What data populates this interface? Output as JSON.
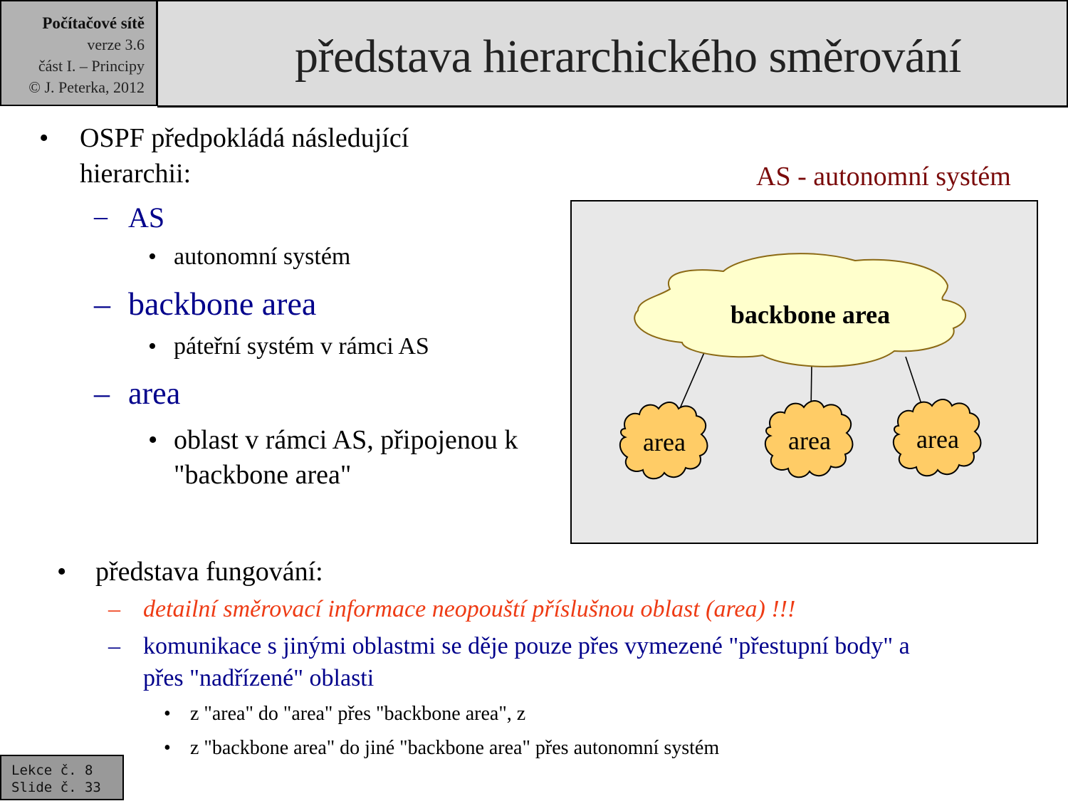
{
  "header": {
    "course": "Počítačové sítě",
    "version": "verze 3.6",
    "part": "část I.  –  Principy",
    "copyright": "© J. Peterka, 2012",
    "title": "představa hierarchického směrování"
  },
  "content": {
    "intro": {
      "bullet": "•",
      "line1": "OSPF předpokládá  následující",
      "line2": "hierarchii:"
    },
    "levels": [
      {
        "dash": "–",
        "term": "AS",
        "bullet": "•",
        "desc": "autonomní systém"
      },
      {
        "dash": "–",
        "term": "backbone area",
        "bullet": "•",
        "desc": "páteřní systém v rámci AS"
      },
      {
        "dash": "–",
        "term": "area",
        "bullet": "•",
        "desc_line1": "oblast v rámci AS, připojenou k",
        "desc_line2": "\"backbone area\""
      }
    ],
    "operation": {
      "bullet": "•",
      "heading": "představa fungování:",
      "points": [
        {
          "dash": "–",
          "text": "detailní směrovací informace neopouští příslušnou oblast (area) !!!"
        },
        {
          "dash": "–",
          "line1": "komunikace s jinými oblastmi se děje pouze přes vymezené \"přestupní body\" a",
          "line2": "přes \"nadřízené\" oblasti"
        }
      ],
      "subpoints": [
        {
          "bullet": "•",
          "text": "z \"area\" do \"area\" přes \"backbone area\", z"
        },
        {
          "bullet": "•",
          "text": "z \"backbone area\" do jiné \"backbone area\" přes autonomní systém"
        }
      ]
    }
  },
  "diagram": {
    "caption": "AS - autonomní systém",
    "backbone_label": "backbone area",
    "area_labels": [
      "area",
      "area",
      "area"
    ],
    "colors": {
      "background": "#e8e8e8",
      "backbone_fill": "#ffffcc",
      "backbone_stroke": "#8b6914",
      "area_fill": "#ffcc66",
      "area_stroke": "#000000"
    }
  },
  "footer": {
    "lesson": "Lekce č. 8",
    "slide": "Slide č. 33"
  }
}
